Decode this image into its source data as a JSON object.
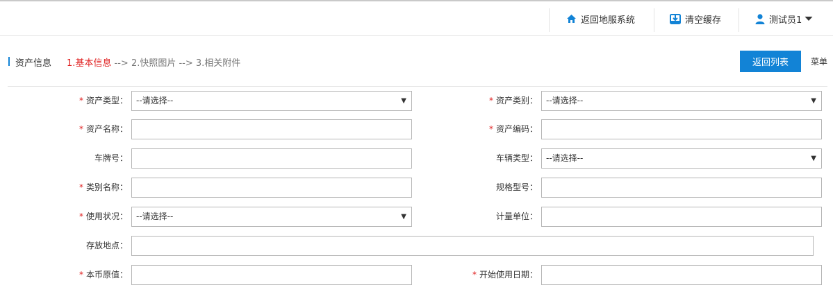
{
  "header": {
    "home_label": "返回地服系统",
    "cache_label": "清空缓存",
    "user_label": "测试员1"
  },
  "titlebar": {
    "title": "资产信息",
    "step1": "1.基本信息",
    "arrow1": " --> ",
    "step2": "2.快照图片",
    "arrow2": " --> ",
    "step3": "3.相关附件",
    "back_button": "返回列表",
    "menu_link": "菜单"
  },
  "form": {
    "required_mark": "*",
    "asset_type": {
      "label": "资产类型：",
      "value": "--请选择--"
    },
    "asset_category": {
      "label": "资产类别：",
      "value": "--请选择--"
    },
    "asset_name": {
      "label": "资产名称：",
      "value": ""
    },
    "asset_code": {
      "label": "资产编码：",
      "value": ""
    },
    "plate_no": {
      "label": "车牌号：",
      "value": ""
    },
    "vehicle_type": {
      "label": "车辆类型：",
      "value": "--请选择--"
    },
    "category_name": {
      "label": "类别名称：",
      "value": ""
    },
    "spec_model": {
      "label": "规格型号：",
      "value": ""
    },
    "usage_status": {
      "label": "使用状况：",
      "value": "--请选择--"
    },
    "unit": {
      "label": "计量单位：",
      "value": ""
    },
    "location": {
      "label": "存放地点：",
      "value": ""
    },
    "original_value": {
      "label": "本币原值：",
      "value": ""
    },
    "start_date": {
      "label": "开始使用日期：",
      "value": ""
    }
  },
  "colors": {
    "accent": "#1283d6",
    "required": "#e02020"
  },
  "icons": {
    "home": "home-icon",
    "cache": "download-box-icon",
    "user": "user-icon",
    "caret": "caret-down-icon"
  }
}
